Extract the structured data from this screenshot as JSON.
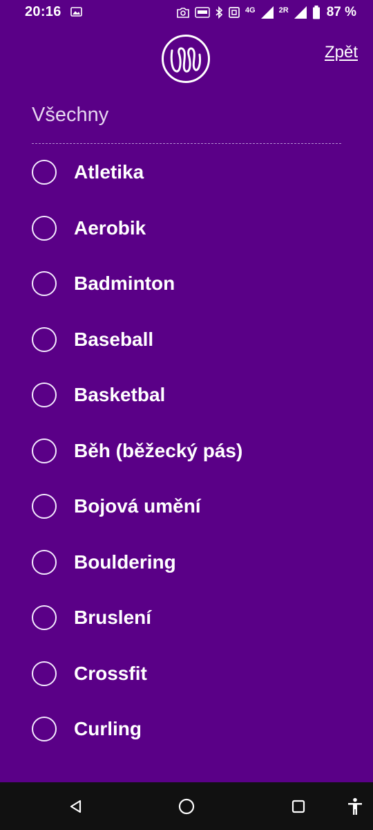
{
  "status_bar": {
    "time": "20:16",
    "network_label": "4G",
    "sim_label": "2R",
    "battery": "87 %"
  },
  "header": {
    "logo_icon": "multisport-logo-icon",
    "back_label": "Zpět"
  },
  "filter": {
    "all_label": "Všechny",
    "sports": [
      {
        "label": "Atletika",
        "selected": false
      },
      {
        "label": "Aerobik",
        "selected": false
      },
      {
        "label": "Badminton",
        "selected": false
      },
      {
        "label": "Baseball",
        "selected": false
      },
      {
        "label": "Basketbal",
        "selected": false
      },
      {
        "label": "Běh (běžecký pás)",
        "selected": false
      },
      {
        "label": "Bojová umění",
        "selected": false
      },
      {
        "label": "Bouldering",
        "selected": false
      },
      {
        "label": "Bruslení",
        "selected": false
      },
      {
        "label": "Crossfit",
        "selected": false
      },
      {
        "label": "Curling",
        "selected": false
      }
    ]
  },
  "colors": {
    "background": "#5a0087",
    "nav_bar": "#111111",
    "text": "#ffffff"
  },
  "nav_bar": {
    "icons": [
      "back-triangle-icon",
      "home-circle-icon",
      "recents-square-icon",
      "accessibility-icon"
    ]
  }
}
